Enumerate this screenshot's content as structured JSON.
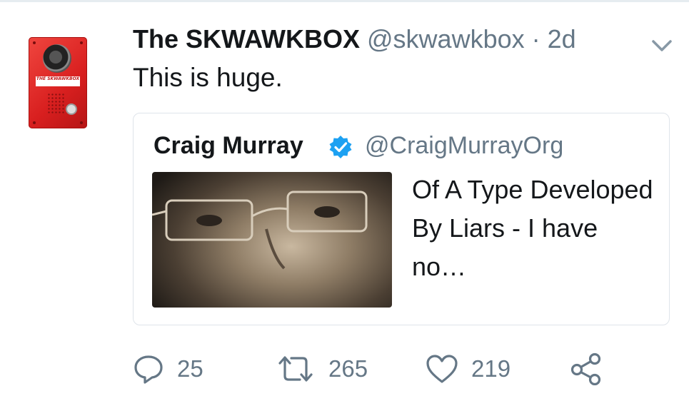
{
  "tweet": {
    "display_name": "The SKWAWKBOX",
    "handle": "@skwawkbox",
    "separator": "·",
    "time": "2d",
    "text": "This is huge.",
    "avatar_text": "THE SKWAWKBOX"
  },
  "quote": {
    "display_name": "Craig Murray",
    "handle": "@CraigMurrayOrg",
    "text": "Of A Type Developed By Liars - I have no…"
  },
  "actions": {
    "replies": "25",
    "retweets": "265",
    "likes": "219"
  },
  "colors": {
    "text": "#14171a",
    "muted": "#657786",
    "verified": "#1da1f2",
    "avatar_red": "#e0302a"
  },
  "icons": [
    "chevron-down-icon",
    "verified-badge-icon",
    "reply-icon",
    "retweet-icon",
    "like-icon",
    "share-icon"
  ]
}
